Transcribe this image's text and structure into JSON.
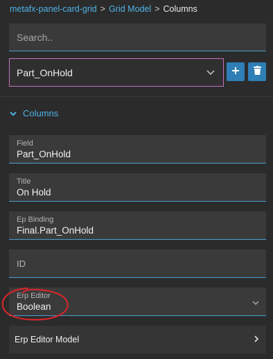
{
  "breadcrumb": {
    "items": [
      {
        "label": "metafx-panel-card-grid"
      },
      {
        "label": "Grid Model"
      }
    ],
    "separator": ">",
    "current": "Columns"
  },
  "search": {
    "placeholder": "Search..",
    "value": ""
  },
  "column_select": {
    "value": "Part_OnHold"
  },
  "buttons": {
    "add": "add-icon",
    "delete": "trash-icon"
  },
  "section": {
    "title": "Columns",
    "expanded": true
  },
  "fields": {
    "field": {
      "label": "Field",
      "value": "Part_OnHold"
    },
    "title": {
      "label": "Title",
      "value": "On Hold"
    },
    "ep_binding": {
      "label": "Ep Binding",
      "value": "Final.Part_OnHold"
    },
    "id": {
      "label": "ID",
      "value": ""
    },
    "erp_editor": {
      "label": "Erp Editor",
      "value": "Boolean"
    }
  },
  "erp_editor_model": {
    "label": "Erp Editor Model"
  },
  "colors": {
    "background": "#2b2b2b",
    "accent": "#4fb3e6",
    "button": "#2f7fb6",
    "select_border": "#c86fc0",
    "annotation": "#d6262c"
  }
}
